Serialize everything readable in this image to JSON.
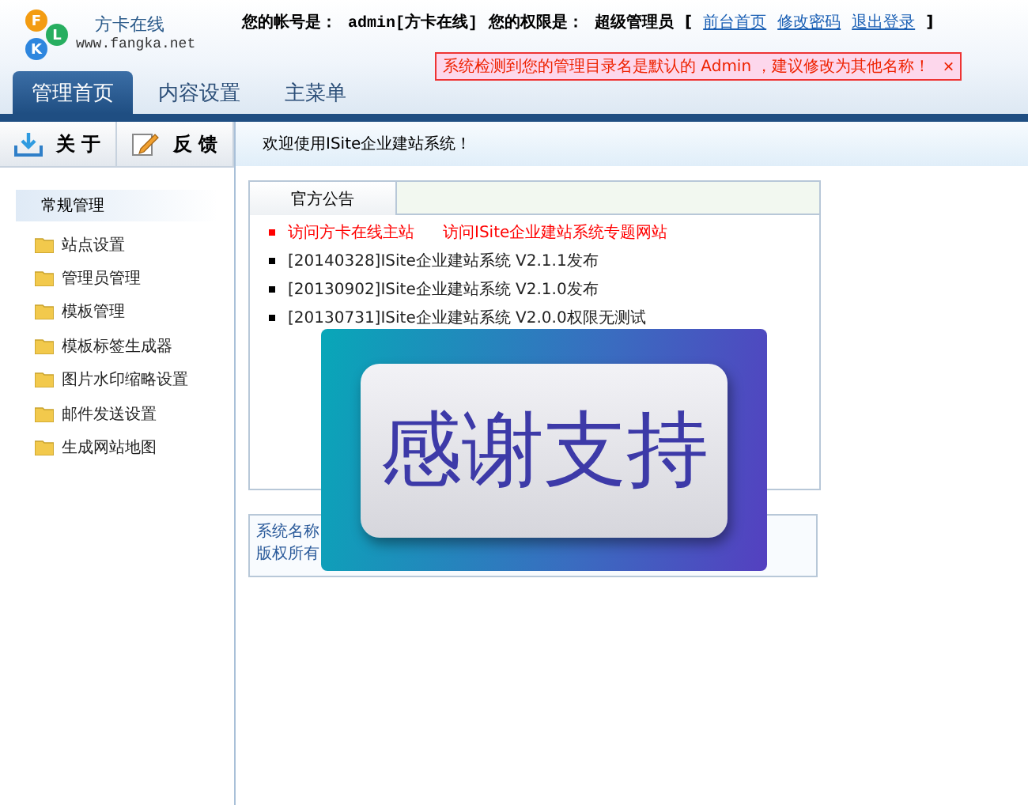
{
  "logo": {
    "letters": [
      "F",
      "K",
      "L"
    ],
    "name": "方卡在线",
    "url": "www.fangka.net"
  },
  "account": {
    "label": "您的帐号是：",
    "value": "admin[方卡在线]",
    "role_label": "您的权限是：",
    "role": "超级管理员",
    "bracket_open": "[",
    "bracket_close": "]",
    "links": [
      "前台首页",
      "修改密码",
      "退出登录"
    ]
  },
  "alert": {
    "text": "系统检测到您的管理目录名是默认的 Admin ，建议修改为其他名称！",
    "close": "×"
  },
  "tabs": [
    {
      "label": "管理首页",
      "selected": true
    },
    {
      "label": "内容设置",
      "selected": false
    },
    {
      "label": "主菜单",
      "selected": false
    }
  ],
  "sidebar": {
    "buttons": [
      {
        "label": "关 于",
        "kind": "download"
      },
      {
        "label": "反 馈",
        "kind": "edit"
      }
    ],
    "section": "常规管理",
    "items": [
      "站点设置",
      "管理员管理",
      "模板管理",
      "模板标签生成器",
      "图片水印缩略设置",
      "邮件发送设置",
      "生成网站地图"
    ]
  },
  "welcome": "欢迎使用ISite企业建站系统！",
  "notice": {
    "tab": "官方公告",
    "links": [
      "访问方卡在线主站",
      "访问ISite企业建站系统专题网站"
    ],
    "items": [
      "[20140328]ISite企业建站系统 V2.1.1发布",
      "[20130902]ISite企业建站系统 V2.1.0发布",
      "[20130731]ISite企业建站系统 V2.0.0权限无测试"
    ]
  },
  "info": [
    "系统名称",
    "版权所有"
  ],
  "overlay": {
    "text": "感谢支持"
  }
}
